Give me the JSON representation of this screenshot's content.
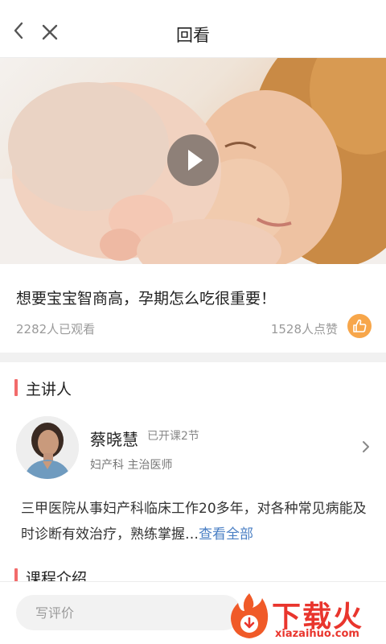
{
  "header": {
    "title": "回看",
    "back_icon": "chevron-left-icon",
    "close_icon": "close-icon"
  },
  "video": {
    "play_icon": "play-icon"
  },
  "course": {
    "title": "想要宝宝智商高，孕期怎么吃很重要！",
    "views": "2282人已观看",
    "likes": "1528人点赞",
    "like_icon": "thumbs-up-icon",
    "like_color": "#f7a64a"
  },
  "lecturer_section": {
    "heading": "主讲人",
    "name": "蔡晓慧",
    "lessons": "已开课2节",
    "title": "妇产科  主治医师",
    "arrow_icon": "chevron-right-icon",
    "description": "三甲医院从事妇产科临床工作20多年，对各种常见病能及时诊断有效治疗，熟练掌握…",
    "more_link": "查看全部"
  },
  "intro_section": {
    "heading": "课程介绍"
  },
  "bottom": {
    "comment_placeholder": "写评价"
  },
  "watermark": {
    "text_cn": "下载火",
    "text_en": "xiazaihuo.com",
    "color": "#e9352d"
  },
  "colors": {
    "accent_red": "#f26b6b",
    "link_blue": "#4a7fc4"
  }
}
